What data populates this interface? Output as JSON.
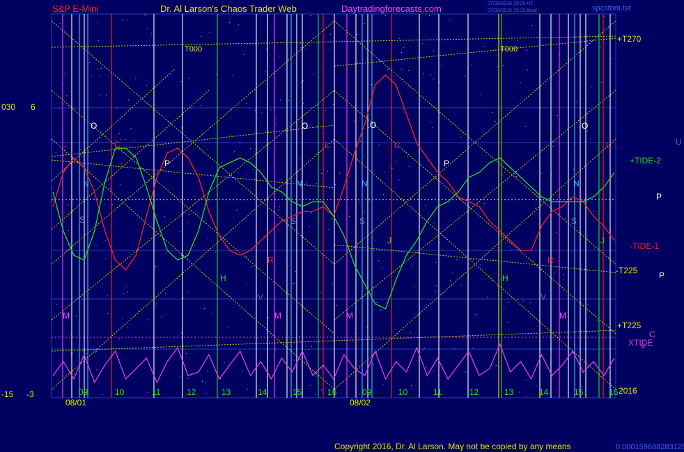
{
  "header": {
    "symbol": "S&P E-Mini",
    "author": "Dr. Al Larson's Chaos Trader Web",
    "site": "Daytradingforecasts.com",
    "stamp1": "07/30/2016 20:20 UT",
    "stamp2": "07/30/2016 19:20 local",
    "file": "spcstom.txt"
  },
  "footer": {
    "copyright": "Copyright 2016, Dr. Al Larson. May not be copied by any means",
    "code": "0.0001596882831259"
  },
  "colors": {
    "background": "#000060",
    "tide_red": "#ff2020",
    "tide_green": "#20e020",
    "xtide": "#e040e0",
    "yellow_lines": "#e8e800",
    "magenta_text": "#ff40ff"
  },
  "chart_data": {
    "type": "line",
    "xlabel": "",
    "ylabel": "",
    "left_axis_top": [
      "030",
      "6"
    ],
    "left_axis_bottom": [
      "-15",
      "-3"
    ],
    "date_labels": [
      "08/01",
      "08/02"
    ],
    "hour_labels": [
      "09",
      "10",
      "11",
      "12",
      "13",
      "14",
      "15",
      "16",
      "09",
      "10",
      "11",
      "12",
      "13",
      "14",
      "15",
      "16"
    ],
    "right_labels": [
      "+T270",
      "+TIDE-2",
      "-TIDE-1",
      "-T225",
      "+T225",
      "XTIDE",
      "2016",
      "P",
      "U",
      "C",
      "Q"
    ],
    "line_labels": [
      "T000",
      "T000"
    ],
    "planet_markers": [
      {
        "text": "O",
        "color": "#ffffff"
      },
      {
        "text": "O",
        "color": "#ffffff"
      },
      {
        "text": "O",
        "color": "#ffffff"
      },
      {
        "text": "O",
        "color": "#ffffff"
      },
      {
        "text": "C",
        "color": "#ff2020"
      },
      {
        "text": "C",
        "color": "#ff2020"
      },
      {
        "text": "C",
        "color": "#ff2020"
      },
      {
        "text": "C",
        "color": "#ff2020"
      },
      {
        "text": "P",
        "color": "#ffffff"
      },
      {
        "text": "P",
        "color": "#ffffff"
      },
      {
        "text": "P",
        "color": "#ffffff"
      },
      {
        "text": "N",
        "color": "#40c0ff"
      },
      {
        "text": "N",
        "color": "#40c0ff"
      },
      {
        "text": "N",
        "color": "#40c0ff"
      },
      {
        "text": "N",
        "color": "#40c0ff"
      },
      {
        "text": "S",
        "color": "#8080c0"
      },
      {
        "text": "S",
        "color": "#8080c0"
      },
      {
        "text": "S",
        "color": "#8080c0"
      },
      {
        "text": "S",
        "color": "#8080c0"
      },
      {
        "text": "H",
        "color": "#20e020"
      },
      {
        "text": "H",
        "color": "#20e020"
      },
      {
        "text": "R",
        "color": "#ff2020"
      },
      {
        "text": "R",
        "color": "#ff2020"
      },
      {
        "text": "V",
        "color": "#4060ff"
      },
      {
        "text": "V",
        "color": "#4060ff"
      },
      {
        "text": "M",
        "color": "#ff40ff"
      },
      {
        "text": "M",
        "color": "#ff40ff"
      },
      {
        "text": "M",
        "color": "#ff40ff"
      },
      {
        "text": "M",
        "color": "#ff40ff"
      },
      {
        "text": "J",
        "color": "#20e020"
      },
      {
        "text": "J",
        "color": "#20e020"
      },
      {
        "text": "r",
        "color": "#a0a0c0"
      }
    ],
    "series": [
      {
        "name": "-TIDE-1",
        "color": "#ff2020",
        "values": [
          -0.1,
          0.6,
          0.9,
          0.7,
          0.2,
          -0.6,
          -1.2,
          -1.4,
          -1.1,
          -0.3,
          0.5,
          1.0,
          1.1,
          0.9,
          0.5,
          -0.2,
          -0.7,
          -1.0,
          -1.1,
          -1.0,
          -0.8,
          -0.6,
          -0.4,
          -0.3,
          -0.2,
          -0.2,
          -0.1,
          -0.3,
          0.3,
          1.0,
          1.6,
          2.4,
          2.6,
          2.4,
          1.8,
          1.2,
          0.9,
          0.6,
          0.4,
          0.1,
          0.0,
          -0.1,
          -0.4,
          -0.6,
          -0.8,
          -1.0,
          -1.0,
          -0.5,
          -0.2,
          -0.1,
          0.1,
          0.0,
          -0.3,
          -0.5,
          -0.8
        ]
      },
      {
        "name": "+TIDE-2",
        "color": "#20e020",
        "values": [
          0.2,
          -0.6,
          -1.1,
          -1.2,
          -0.6,
          0.4,
          1.1,
          1.1,
          0.9,
          0.3,
          -0.4,
          -1.0,
          -1.2,
          -1.1,
          -0.6,
          0.2,
          0.7,
          0.8,
          0.9,
          0.8,
          0.6,
          0.3,
          0.2,
          0.0,
          -0.1,
          0.0,
          0.0,
          -0.3,
          -0.7,
          -1.3,
          -1.7,
          -2.1,
          -2.2,
          -1.6,
          -1.1,
          -0.8,
          -0.4,
          -0.1,
          0.0,
          0.2,
          0.5,
          0.6,
          0.8,
          0.9,
          0.7,
          0.5,
          0.3,
          0.1,
          0.0,
          0.0,
          0.0,
          0.0,
          0.1,
          0.3,
          0.6
        ]
      },
      {
        "name": "XTIDE",
        "color": "#e040e0",
        "values": [
          0.2,
          0.6,
          0.1,
          0.8,
          0.0,
          0.5,
          0.9,
          0.1,
          0.4,
          0.7,
          0.0,
          0.6,
          1.0,
          0.2,
          0.3,
          0.8,
          0.1,
          0.5,
          0.9,
          0.2,
          0.6,
          0.1,
          0.7,
          0.3,
          0.9,
          0.2,
          0.5,
          0.1,
          0.8,
          0.4,
          0.2,
          0.9,
          0.1,
          0.6,
          0.3,
          1.0,
          0.2,
          0.7,
          0.1,
          0.5,
          0.9,
          0.2,
          0.4,
          1.1,
          0.3,
          0.6,
          0.1,
          0.8,
          0.2,
          0.5,
          0.9,
          0.3,
          0.6,
          0.2,
          0.7
        ]
      }
    ]
  }
}
